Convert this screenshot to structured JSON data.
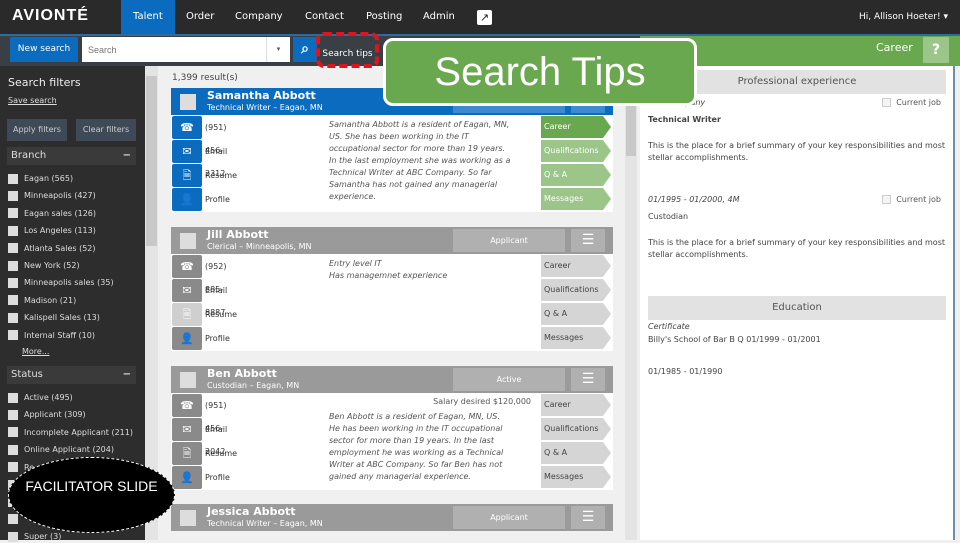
{
  "app": {
    "logo": "AVIONTÉ",
    "user": "Hi, Allison Hoeter! ▾",
    "external_icon": "external-link-icon"
  },
  "nav": [
    "Talent",
    "Order",
    "Company",
    "Contact",
    "Posting",
    "Admin"
  ],
  "toolbar": {
    "new_search": "New search",
    "search_placeholder": "Search",
    "dropdown": "▾",
    "search_icon": "🔍",
    "search_tips": "Search tips",
    "callout": "Search Tips",
    "career": "Career",
    "help": "?"
  },
  "sidebar": {
    "title": "Search filters",
    "save": "Save search",
    "apply": "Apply filters",
    "clear": "Clear filters",
    "branch": {
      "title": "Branch",
      "toggle": "−",
      "items": [
        "Eagan (565)",
        "Minneapolis (427)",
        "Eagan sales (126)",
        "Los Angeles (113)",
        "Atlanta Sales (52)",
        "New York (52)",
        "Minneapolis sales (35)",
        "Madison (21)",
        "Kalispell Sales (13)",
        "Internal Staff (10)"
      ],
      "more": "More..."
    },
    "status": {
      "title": "Status",
      "toggle": "−",
      "items": [
        "Active (495)",
        "Applicant (309)",
        "Incomplete Applicant (211)",
        "Online Applicant (204)",
        "Re...",
        "",
        "",
        "",
        "Super (3)"
      ]
    }
  },
  "results": {
    "count": "1,399 result(s)",
    "tabs": [
      "Career",
      "Qualifications",
      "Q & A",
      "Messages"
    ],
    "labels": [
      "Email",
      "Resume",
      "Profile"
    ],
    "cards": [
      {
        "name": "Samantha Abbott",
        "sub": "Technical Writer – Eagan, MN",
        "status": "",
        "phone": "(951) 456-2312",
        "salary": "",
        "desc": "Samantha Abbott is a resident of Eagan, MN, US. She has been working in the IT occupational sector for more than 19 years. In the last employment she was working as a Technical Writer at ABC Company. So far Samantha has not gained any managerial experience."
      },
      {
        "name": "Jill Abbott",
        "sub": "Clerical – Minneapolis, MN",
        "status": "Applicant",
        "phone": "(952) 885-8887",
        "salary": "",
        "desc": "Entry level IT\nHas managemnet experience"
      },
      {
        "name": "Ben Abbott",
        "sub": "Custodian – Eagan, MN",
        "status": "Active",
        "phone": "(951) 456-2042",
        "salary": "Salary desired $120,000",
        "desc": "Ben Abbott is a resident of Eagan, MN, US. He has been working in the IT occupational sector for more than 19 years. In the last employment he was working as a Technical Writer at ABC Company. So far Ben has not gained any managerial experience."
      },
      {
        "name": "Jessica Abbott",
        "sub": "Technical Writer – Eagan, MN",
        "status": "Applicant",
        "phone": "",
        "salary": "",
        "desc": ""
      }
    ]
  },
  "right": {
    "prof": "Professional experience",
    "company": "ABC Company",
    "current_job": "Current job",
    "job1": "Technical Writer",
    "summary": "This is the place for a brief summary of your key responsibilities and most stellar accomplishments.",
    "dates2": "01/1995 - 01/2000, 4M",
    "job2": "Custodian",
    "edu": "Education",
    "cert": "Certificate",
    "school": "Billy's School of Bar B Q  01/1999 - 01/2001",
    "dates3": "01/1985 - 01/1990"
  },
  "overlay": {
    "facilitator": "FACILITATOR SLIDE"
  },
  "colors": {
    "brand_blue": "#0b6cbf",
    "green": "#6aa84f",
    "dark": "#2a2a2a",
    "red_highlight": "#e0141e"
  }
}
